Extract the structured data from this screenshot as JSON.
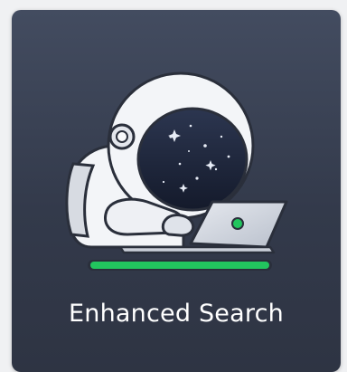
{
  "card": {
    "title": "Enhanced Search",
    "illustration_icon": "astronaut-laptop-icon",
    "accent_color": "#22c55e",
    "background_color": "#3a4254"
  }
}
